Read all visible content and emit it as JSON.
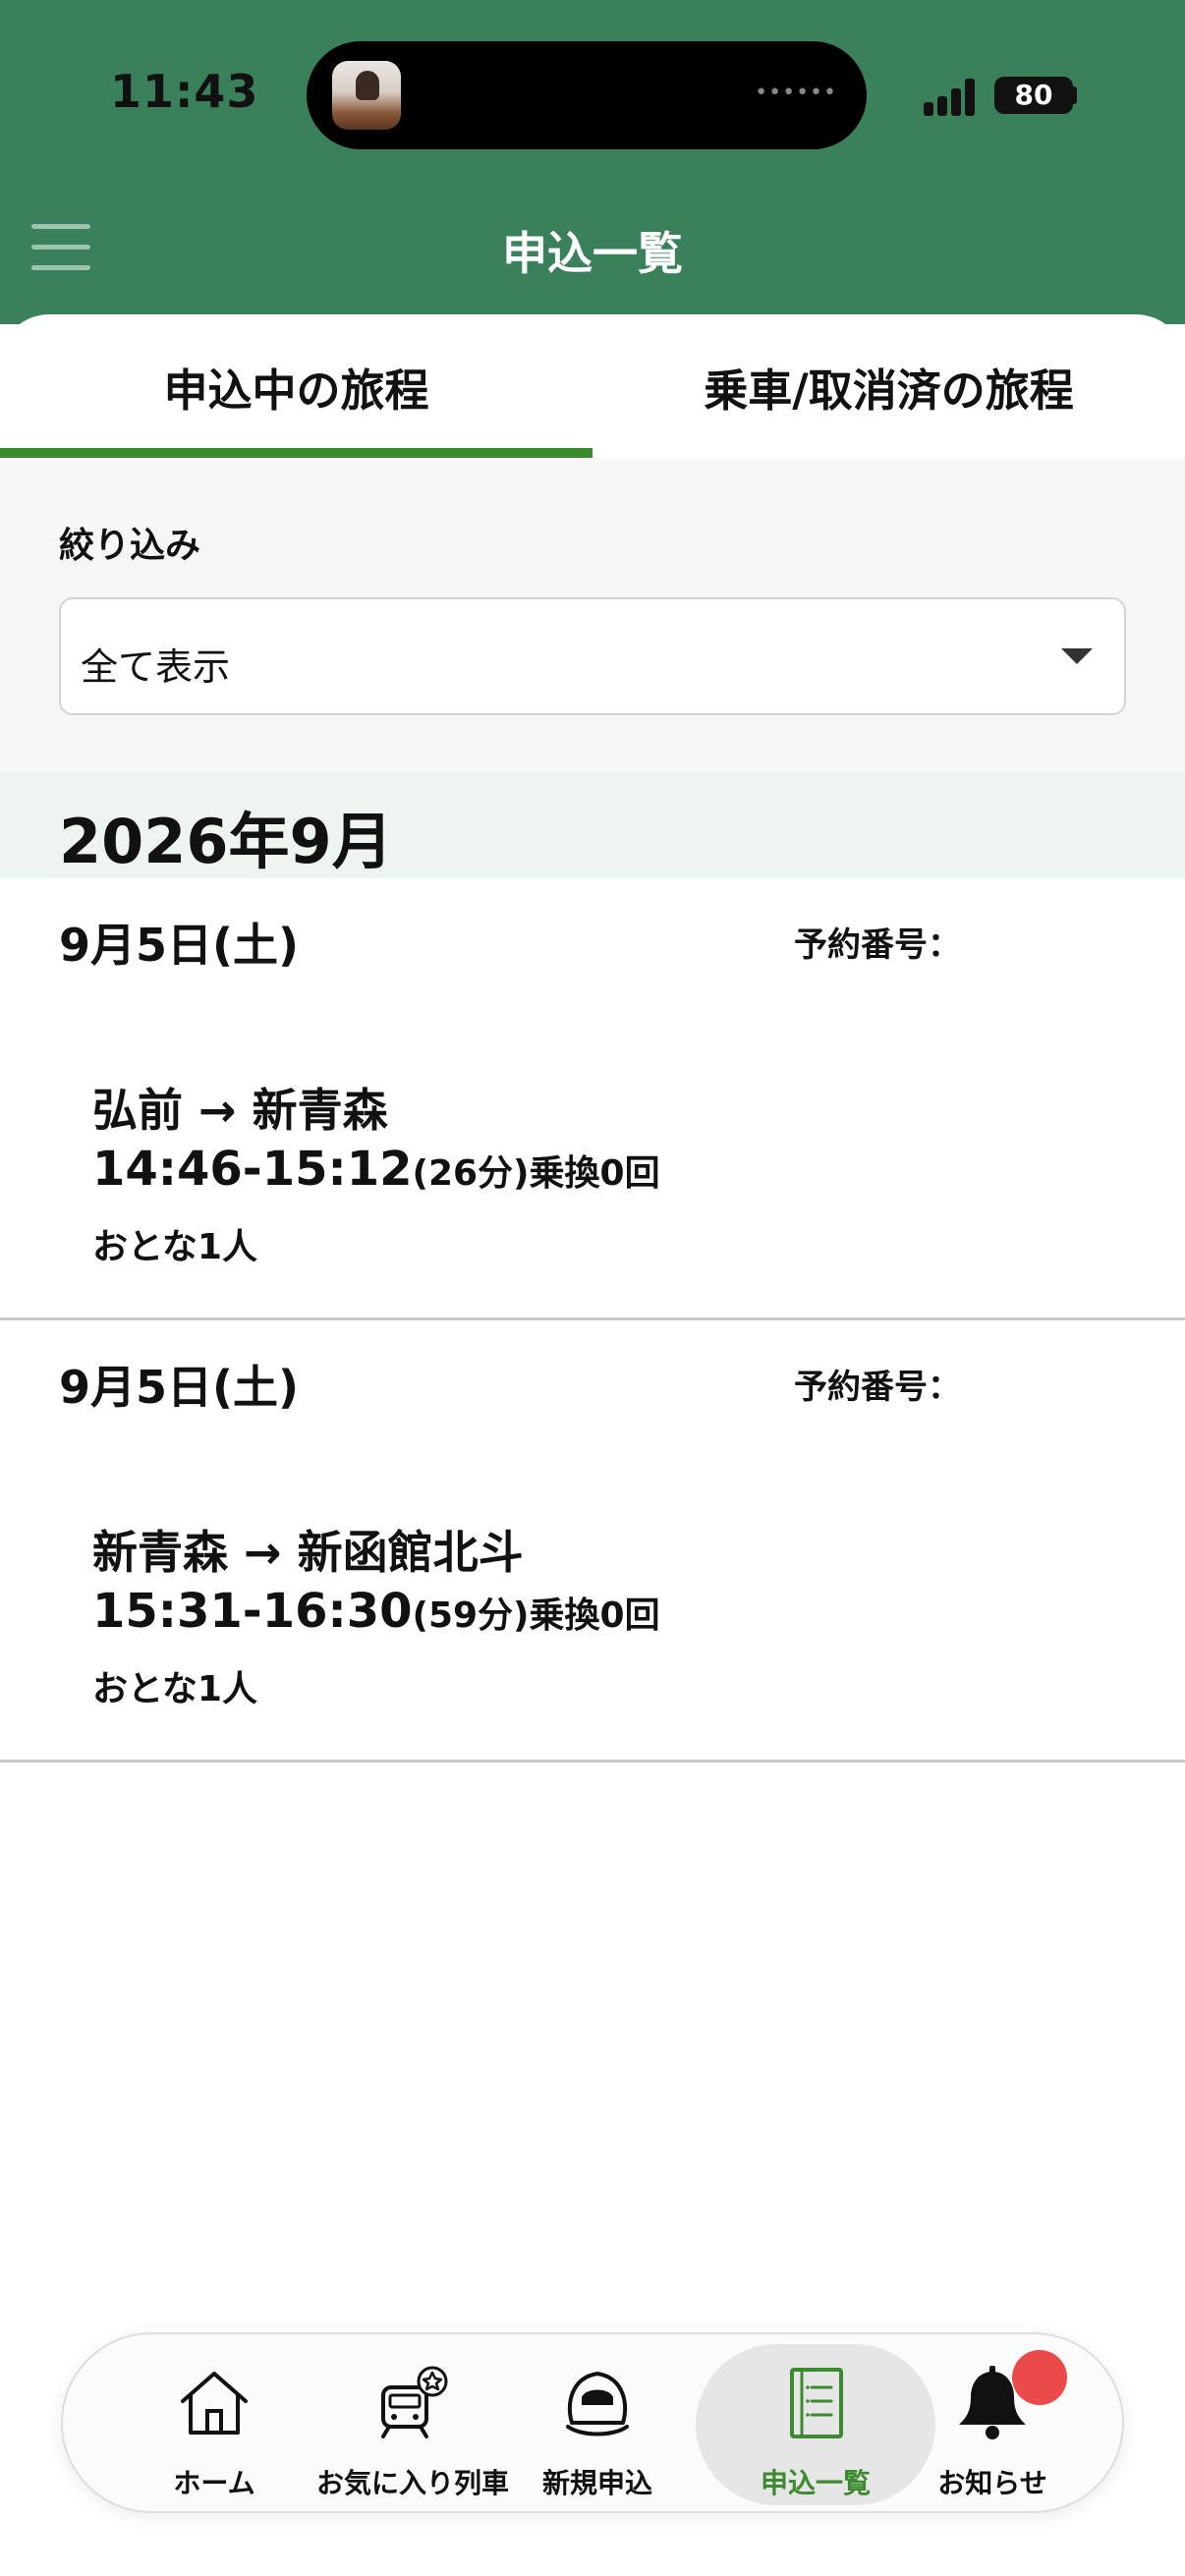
{
  "status_bar": {
    "time": "11:43",
    "island_dots": "••••••",
    "battery": "80"
  },
  "header": {
    "title": "申込一覧"
  },
  "tabs": [
    {
      "label": "申込中の旅程",
      "active": true
    },
    {
      "label": "乗車/取消済の旅程",
      "active": false
    }
  ],
  "filter": {
    "label": "絞り込み",
    "value": "全て表示"
  },
  "month": "2026年9月",
  "trips": [
    {
      "date": "9月5日(土)",
      "reservation_label": "予約番号：",
      "route": "弘前 → 新青森",
      "time": "14:46-15:12",
      "duration": "(26分)",
      "transfers": "乗換0回",
      "passengers": "おとな1人"
    },
    {
      "date": "9月5日(土)",
      "reservation_label": "予約番号：",
      "route": "新青森 → 新函館北斗",
      "time": "15:31-16:30",
      "duration": "(59分)",
      "transfers": "乗換0回",
      "passengers": "おとな1人"
    }
  ],
  "nav": [
    {
      "label": "ホーム",
      "icon": "home-icon"
    },
    {
      "label": "お気に入り列車",
      "icon": "favorite-train-icon"
    },
    {
      "label": "新規申込",
      "icon": "new-application-train-icon"
    },
    {
      "label": "申込一覧",
      "icon": "application-list-icon",
      "active": true
    },
    {
      "label": "お知らせ",
      "icon": "bell-icon"
    }
  ],
  "colors": {
    "header_green": "#3a805b",
    "accent_green": "#3b8a2f",
    "notification_red": "#ea4a4a"
  }
}
